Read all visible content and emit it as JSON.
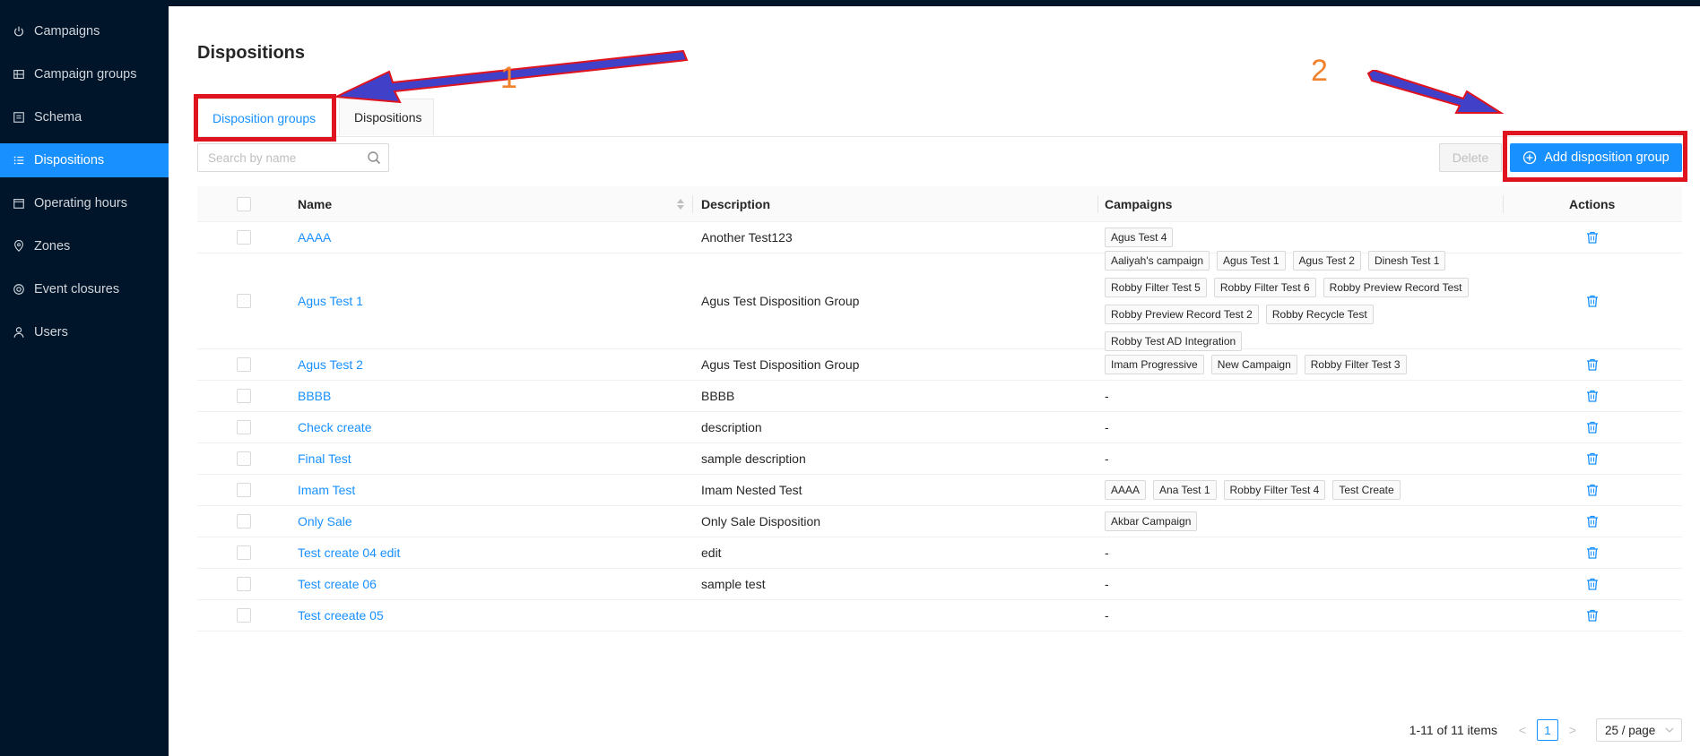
{
  "sidebar": {
    "items": [
      {
        "label": "Campaigns",
        "icon": "power-icon"
      },
      {
        "label": "Campaign groups",
        "icon": "campaign-groups-icon"
      },
      {
        "label": "Schema",
        "icon": "schema-icon"
      },
      {
        "label": "Dispositions",
        "icon": "list-icon",
        "active": true
      },
      {
        "label": "Operating hours",
        "icon": "calendar-icon"
      },
      {
        "label": "Zones",
        "icon": "location-icon"
      },
      {
        "label": "Event closures",
        "icon": "target-icon"
      },
      {
        "label": "Users",
        "icon": "user-icon"
      }
    ]
  },
  "page": {
    "title": "Dispositions"
  },
  "tabs": [
    {
      "label": "Disposition groups",
      "active": true
    },
    {
      "label": "Dispositions",
      "active": false
    }
  ],
  "annotations": {
    "one": "1",
    "two": "2",
    "highlight_color": "#e0141e",
    "number_color": "#f0822d",
    "arrow_color": "#4040c8"
  },
  "search": {
    "placeholder": "Search by name",
    "value": ""
  },
  "toolbar": {
    "delete_label": "Delete",
    "add_label": "Add disposition group"
  },
  "table": {
    "columns": {
      "name": "Name",
      "description": "Description",
      "campaigns": "Campaigns",
      "actions": "Actions"
    },
    "rows": [
      {
        "name": "AAAA",
        "description": "Another Test123",
        "campaigns": [
          "Agus Test 4"
        ],
        "empty": "-"
      },
      {
        "name": "Agus Test 1",
        "description": "Agus Test Disposition Group",
        "campaigns": [
          "Aaliyah's campaign",
          "Agus Test 1",
          "Agus Test 2",
          "Dinesh Test 1",
          "Robby Filter Test 5",
          "Robby Filter Test 6",
          "Robby Preview Record Test",
          "Robby Preview Record Test 2",
          "Robby Recycle Test",
          "Robby Test AD Integration"
        ],
        "empty": "-"
      },
      {
        "name": "Agus Test 2",
        "description": "Agus Test Disposition Group",
        "campaigns": [
          "Imam Progressive",
          "New Campaign",
          "Robby Filter Test 3"
        ],
        "empty": "-"
      },
      {
        "name": "BBBB",
        "description": "BBBB",
        "campaigns": [],
        "empty": "-"
      },
      {
        "name": "Check create",
        "description": "description",
        "campaigns": [],
        "empty": "-"
      },
      {
        "name": "Final Test",
        "description": "sample description",
        "campaigns": [],
        "empty": "-"
      },
      {
        "name": "Imam Test",
        "description": "Imam Nested Test",
        "campaigns": [
          "AAAA",
          "Ana Test 1",
          "Robby Filter Test 4",
          "Test Create"
        ],
        "empty": "-"
      },
      {
        "name": "Only Sale",
        "description": "Only Sale Disposition",
        "campaigns": [
          "Akbar Campaign"
        ],
        "empty": "-"
      },
      {
        "name": "Test create 04 edit",
        "description": "edit",
        "campaigns": [],
        "empty": "-"
      },
      {
        "name": "Test create 06",
        "description": "sample test",
        "campaigns": [],
        "empty": "-"
      },
      {
        "name": "Test creeate 05",
        "description": "",
        "campaigns": [],
        "empty": "-"
      }
    ]
  },
  "pagination": {
    "total_text": "1-11 of 11 items",
    "current_page": "1",
    "page_size": "25 / page",
    "prev": "<",
    "next": ">"
  },
  "colors": {
    "sidebar_bg": "#001529",
    "accent": "#1890ff",
    "link": "#1890ff"
  }
}
